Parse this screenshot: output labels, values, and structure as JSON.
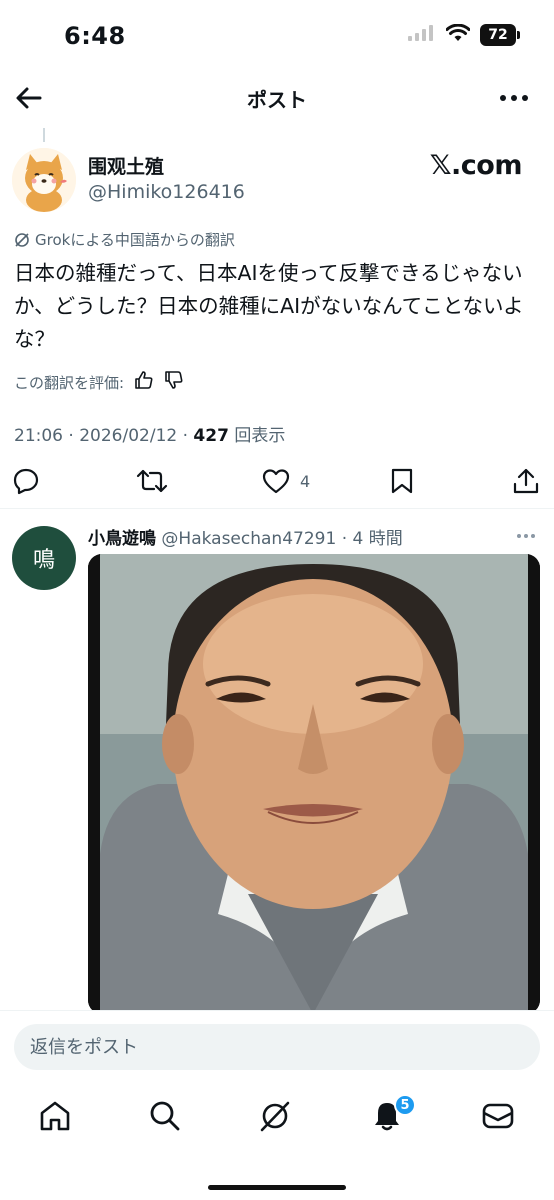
{
  "status_bar": {
    "time": "6:48",
    "battery": "72"
  },
  "header": {
    "title": "ポスト"
  },
  "post": {
    "author_name": "围观土殖",
    "author_handle": "@Himiko126416",
    "brand": "𝕏.com",
    "translation_note": "Grokによる中国語からの翻訳",
    "text": "日本の雑種だって、日本AIを使って反撃できるじゃないか、どうした？日本の雑種にAIがないなんてことないよな？",
    "rate_label": "この翻訳を評価:",
    "time": "21:06",
    "date": "2026/02/12",
    "views_count": "427",
    "views_label": "回表示",
    "like_count": "4"
  },
  "reply": {
    "avatar_char": "鳴",
    "name": "小鳥遊鳴",
    "handle": "@Hakasechan47291",
    "time_ago": "4 時間"
  },
  "compose": {
    "placeholder": "返信をポスト"
  },
  "tab_bar": {
    "notification_count": "5"
  },
  "colors": {
    "accent": "#1d9bf0",
    "text": "#0f1419",
    "secondary": "#536471"
  }
}
